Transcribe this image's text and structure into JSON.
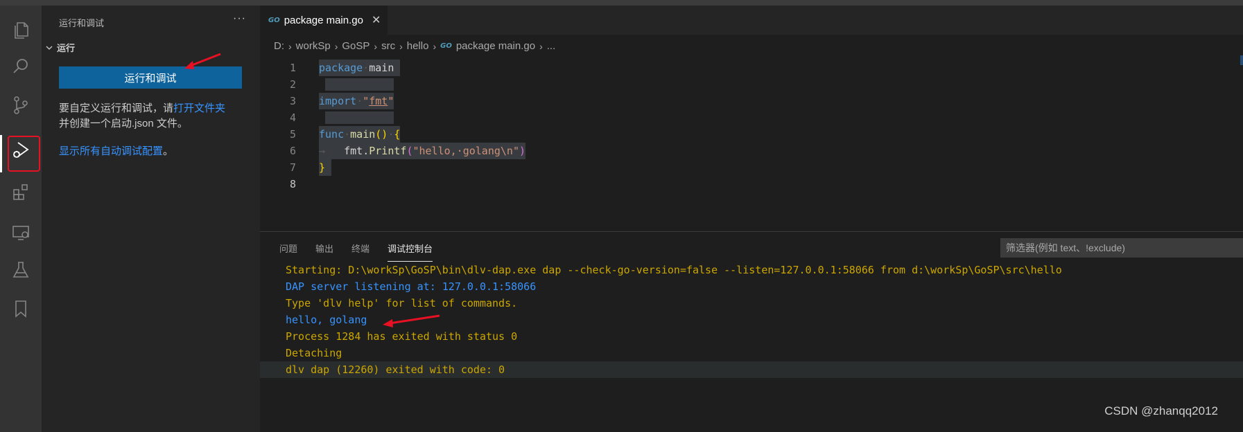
{
  "activity_bar": {
    "icons": [
      "explorer-icon",
      "search-icon",
      "source-control-icon",
      "run-debug-icon",
      "extensions-icon",
      "remote-explorer-icon",
      "testing-icon",
      "bookmarks-icon"
    ]
  },
  "sidebar": {
    "title": "运行和调试",
    "more": "···",
    "section": "运行",
    "run_button": "运行和调试",
    "desc_before": "要自定义运行和调试，请",
    "desc_link": "打开文件夹",
    "desc_after": "并创建一个启动.json 文件。",
    "show_all_link": "显示所有自动调试配置",
    "show_all_suffix": "。"
  },
  "editor": {
    "tab_label": "package main.go",
    "tab_icon": "GO",
    "tab_close": "✕",
    "breadcrumb": [
      "D:",
      "workSp",
      "GoSP",
      "src",
      "hello",
      "package main.go",
      "..."
    ],
    "code_lines": [
      {
        "n": "1",
        "text": "package main"
      },
      {
        "n": "2",
        "text": ""
      },
      {
        "n": "3",
        "text": "import \"fmt\""
      },
      {
        "n": "4",
        "text": ""
      },
      {
        "n": "5",
        "text": "func main() {"
      },
      {
        "n": "6",
        "text": "    fmt.Printf(\"hello, golang\\n\")"
      },
      {
        "n": "7",
        "text": "}"
      },
      {
        "n": "8",
        "text": ""
      }
    ]
  },
  "panel": {
    "tabs": [
      "问题",
      "输出",
      "终端",
      "调试控制台"
    ],
    "active_tab": "调试控制台",
    "filter_placeholder": "筛选器(例如 text、!exclude)",
    "console_lines": [
      {
        "text": "Starting: D:\\workSp\\GoSP\\bin\\dlv-dap.exe dap --check-go-version=false --listen=127.0.0.1:58066 from d:\\workSp\\GoSP\\src\\hello",
        "color": "#cca700"
      },
      {
        "text": "DAP server listening at: 127.0.0.1:58066",
        "color": "#3794ff"
      },
      {
        "text": "Type 'dlv help' for list of commands.",
        "color": "#cca700"
      },
      {
        "text": "hello, golang",
        "color": "#3794ff"
      },
      {
        "text": "Process 1284 has exited with status 0",
        "color": "#cca700"
      },
      {
        "text": "Detaching",
        "color": "#cca700"
      },
      {
        "text": "dlv dap (12260) exited with code: 0",
        "color": "#cca700"
      }
    ]
  },
  "watermark": "CSDN @zhanqq2012",
  "colors": {
    "activity_bar": "#333333",
    "sidebar": "#252526",
    "editor": "#1e1e1e",
    "button": "#0e639c",
    "link": "#3794ff",
    "annotation_red": "#e81123"
  }
}
